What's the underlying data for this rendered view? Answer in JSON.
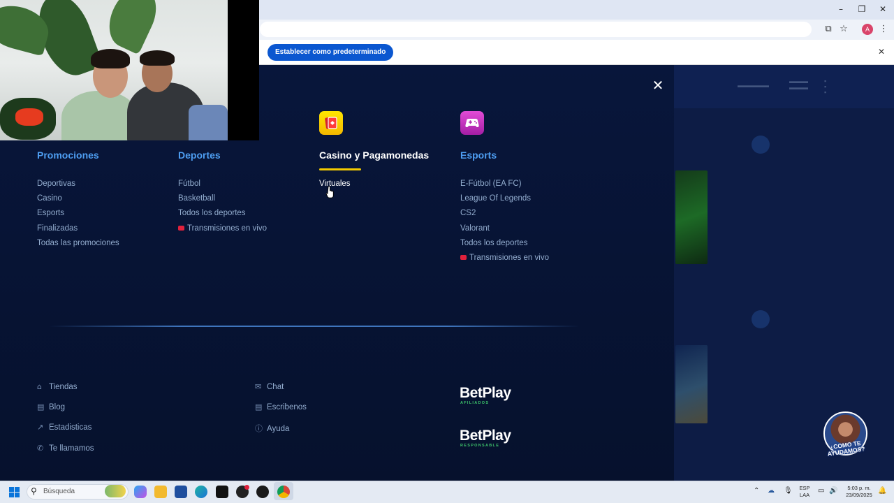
{
  "browser": {
    "infobar_button": "Establecer como predeterminado",
    "profile_initial": "A",
    "window_controls": [
      "–",
      "❐",
      "✕"
    ]
  },
  "menu": {
    "columns": [
      {
        "title": "Promociones",
        "items": [
          "Deportivas",
          "Casino",
          "Esports",
          "Finalizadas",
          "Todas las promociones"
        ]
      },
      {
        "title": "Deportes",
        "items": [
          "Fútbol",
          "Basketball",
          "Todos los deportes"
        ],
        "live": "Transmisiones en vivo"
      },
      {
        "title": "Casino y Pagamonedas",
        "items": [
          "Virtuales"
        ],
        "icon": "cards-icon",
        "active": true
      },
      {
        "title": "Esports",
        "items": [
          "E-Fútbol (EA FC)",
          "League Of Legends",
          "CS2",
          "Valorant",
          "Todos los deportes"
        ],
        "live": "Transmisiones en vivo",
        "icon": "gamepad-icon"
      }
    ]
  },
  "footer": {
    "links_left": [
      "Tiendas",
      "Blog",
      "Estadisticas",
      "Te llamamos"
    ],
    "links_right": [
      "Chat",
      "Escribenos",
      "Ayuda"
    ],
    "brand_1": {
      "name": "BetPlay",
      "sub": "AFILIADOS"
    },
    "brand_2": {
      "name": "BetPlay",
      "sub": "RESPONSABLE"
    }
  },
  "help_widget": {
    "text": "¿COMO TE AYUDAMOS?"
  },
  "taskbar": {
    "search_placeholder": "Búsqueda",
    "lang_1": "ESP",
    "lang_2": "LAA",
    "time": "5:03 p. m.",
    "date": "23/09/2025"
  },
  "colors": {
    "panel_bg": "#07112b",
    "title_blue": "#4e9ef2",
    "link_gray": "#93adcf",
    "active_underline": "#f3c900",
    "live_red": "#e0213c"
  }
}
